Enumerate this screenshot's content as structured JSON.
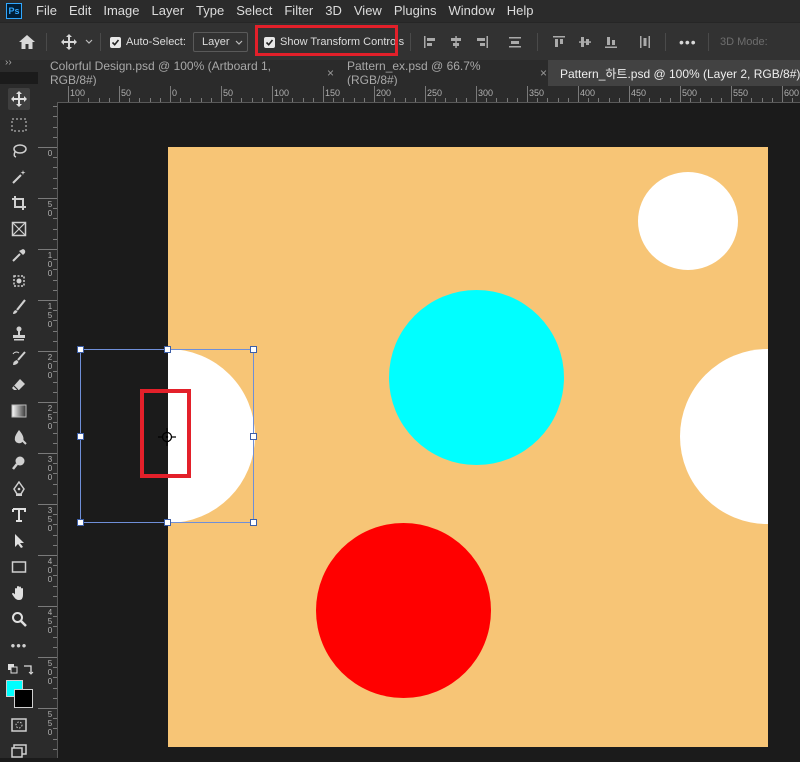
{
  "app": {
    "logo_text": "Ps"
  },
  "menu": [
    "File",
    "Edit",
    "Image",
    "Layer",
    "Type",
    "Select",
    "Filter",
    "3D",
    "View",
    "Plugins",
    "Window",
    "Help"
  ],
  "options": {
    "auto_select_label": "Auto-Select:",
    "auto_select_checked": true,
    "layer_dropdown_value": "Layer",
    "show_transform_label": "Show Transform Controls",
    "show_transform_checked": true,
    "more_label": "•••",
    "mode_label": "3D Mode:"
  },
  "tabs": [
    {
      "label": "Colorful Design.psd @ 100% (Artboard 1, RGB/8#)",
      "close": "×",
      "active": false
    },
    {
      "label": "Pattern_ex.psd @ 66.7% (RGB/8#)",
      "close": "×",
      "active": false
    },
    {
      "label": "Pattern_하트.psd @ 100% (Layer 2, RGB/8#) *",
      "close": "",
      "active": true
    }
  ],
  "hruler_labels": [
    "100",
    "50",
    "0",
    "50",
    "100",
    "150",
    "200",
    "250",
    "300",
    "350",
    "400",
    "450",
    "500",
    "550",
    "600"
  ],
  "vruler_labels": [
    "0",
    "5\n0",
    "1\n0\n0",
    "1\n5\n0",
    "2\n0\n0",
    "2\n5\n0",
    "3\n0\n0",
    "3\n5\n0",
    "4\n0\n0",
    "4\n5\n0",
    "5\n0\n0",
    "5\n5\n0",
    "6"
  ],
  "colors": {
    "canvas_bg": "#f7c576",
    "foreground": "#00ffff",
    "background": "#000000",
    "circle_white": "#ffffff",
    "circle_cyan": "#00ffff",
    "circle_red": "#ff0000",
    "highlight": "#e3202a"
  },
  "tools": [
    "move-tool",
    "marquee-tool",
    "lasso-tool",
    "magic-wand-tool",
    "crop-tool",
    "frame-tool",
    "eyedropper-tool",
    "healing-brush-tool",
    "brush-tool",
    "clone-stamp-tool",
    "history-brush-tool",
    "eraser-tool",
    "gradient-tool",
    "blur-tool",
    "dodge-tool",
    "pen-tool",
    "type-tool",
    "path-selection-tool",
    "rectangle-tool",
    "hand-tool",
    "zoom-tool",
    "edit-toolbar",
    "quick-mask",
    "screen-mode"
  ],
  "tool_panel_expand": "››",
  "more_tools_label": "•••"
}
